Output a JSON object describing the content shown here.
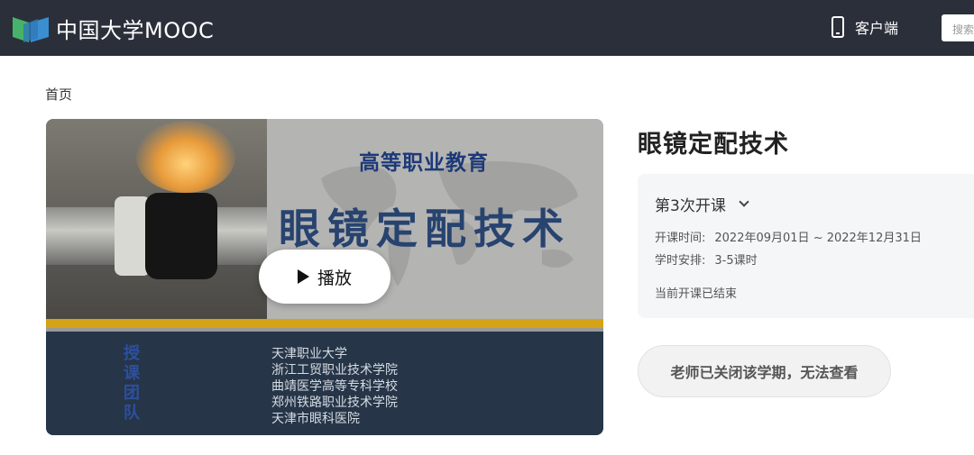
{
  "header": {
    "logo_text": "中国大学MOOC",
    "client_label": "客户端",
    "search_placeholder": "搜索"
  },
  "breadcrumb": {
    "home": "首页"
  },
  "video": {
    "slide_subtitle": "高等职业教育",
    "slide_title": "眼镜定配技术",
    "team_label": "授课团队",
    "schools": [
      "天津职业大学",
      "浙江工贸职业技术学院",
      "曲靖医学高等专科学校",
      "郑州铁路职业技术学院",
      "天津市眼科医院"
    ],
    "play_label": "播放"
  },
  "course": {
    "title": "眼镜定配技术",
    "term_label": "第3次开课",
    "time_label": "开课时间:",
    "time_value": "2022年09月01日 ~ 2022年12月31日",
    "schedule_label": "学时安排:",
    "schedule_value": "3-5课时",
    "status": "当前开课已结束",
    "closed_button": "老师已关闭该学期，无法查看"
  },
  "colors": {
    "topbar": "#2b2f3a",
    "logo_green": "#46b26a",
    "logo_blue": "#3b8fd0",
    "slide_navy": "#263648",
    "slide_gold": "#d4a318"
  }
}
